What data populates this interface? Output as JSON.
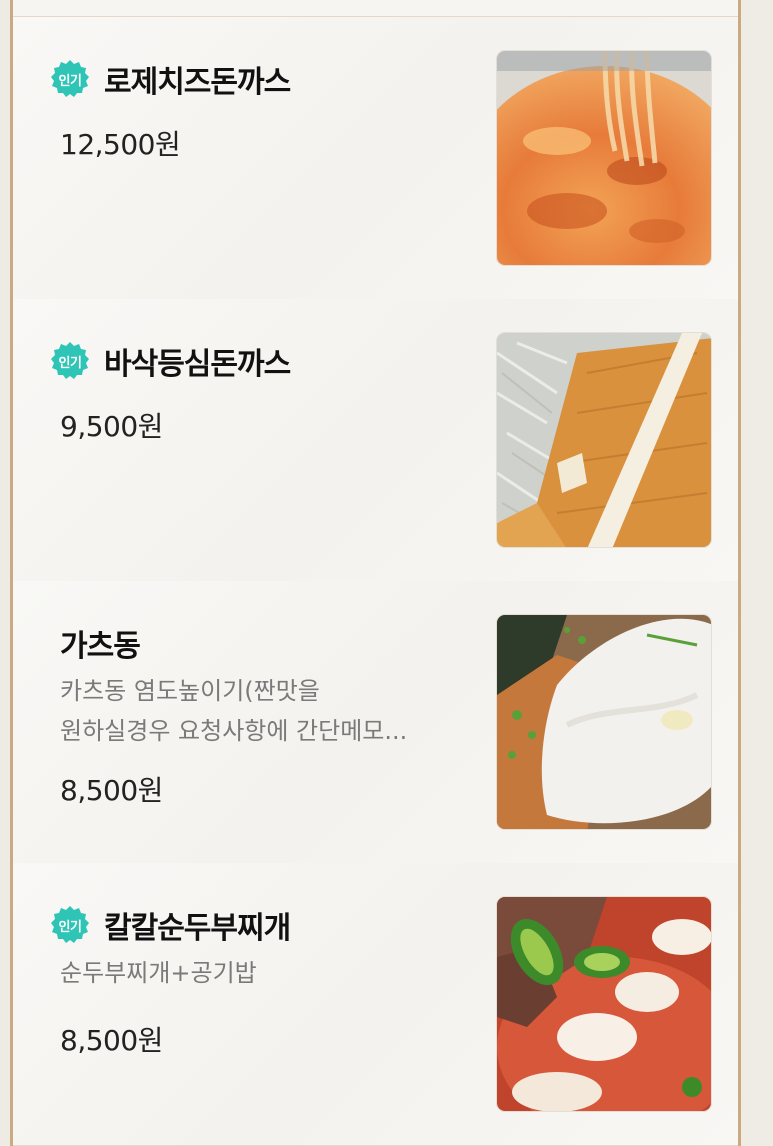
{
  "badge_label": "인기",
  "menu": [
    {
      "name": "로제치즈돈까스",
      "description": [],
      "price": "12,500원",
      "popular": true,
      "image": "rose-cheese-tonkatsu-photo"
    },
    {
      "name": "바삭등심돈까스",
      "description": [],
      "price": "9,500원",
      "popular": true,
      "image": "crispy-loin-tonkatsu-photo"
    },
    {
      "name": "가츠동",
      "description": [
        "카츠동 염도높이기(짠맛을",
        "원하실경우  요청사항에 간단메모..."
      ],
      "price": "8,500원",
      "popular": false,
      "image": "katsudon-photo"
    },
    {
      "name": "칼칼순두부찌개",
      "description": [
        "순두부찌개+공기밥"
      ],
      "price": "8,500원",
      "popular": true,
      "image": "spicy-soft-tofu-stew-photo"
    }
  ],
  "colors": {
    "badge": "#2ec4b6",
    "border": "#cba981",
    "divider": "#e6d8c6"
  }
}
